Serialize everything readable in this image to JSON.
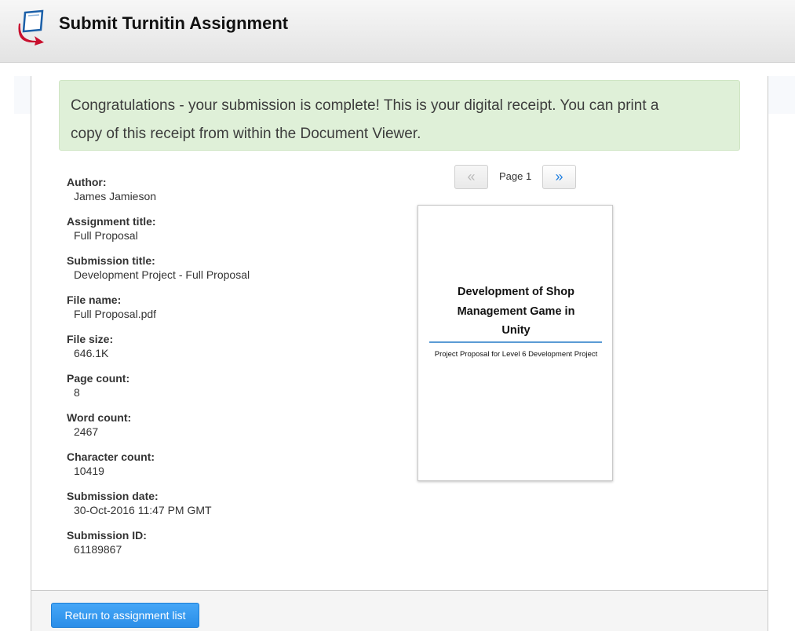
{
  "header": {
    "title": "Submit Turnitin Assignment",
    "logo_icon": "turnitin-logo-icon"
  },
  "alert": {
    "line1": "Congratulations - your submission is complete! This is your digital receipt. You can print a",
    "line2": "copy of this receipt from within the Document Viewer."
  },
  "details": [
    {
      "label": "Author:",
      "value": "James Jamieson"
    },
    {
      "label": "Assignment title:",
      "value": "Full Proposal"
    },
    {
      "label": "Submission title:",
      "value": "Development Project - Full Proposal"
    },
    {
      "label": "File name:",
      "value": "Full Proposal.pdf"
    },
    {
      "label": "File size:",
      "value": "646.1K"
    },
    {
      "label": "Page count:",
      "value": "8"
    },
    {
      "label": "Word count:",
      "value": "2467"
    },
    {
      "label": "Character count:",
      "value": "10419"
    },
    {
      "label": "Submission date:",
      "value": "30-Oct-2016 11:47 PM GMT"
    },
    {
      "label": "Submission ID:",
      "value": "61189867"
    }
  ],
  "pager": {
    "prev_label": "«",
    "page_label": "Page 1",
    "next_label": "»"
  },
  "preview": {
    "title_line1": "Development of Shop",
    "title_line2": "Management Game in",
    "title_line3": "Unity",
    "subtitle": "Project Proposal for Level 6 Development Project"
  },
  "footer": {
    "return_label": "Return to assignment list"
  },
  "colors": {
    "success_bg": "#dff0d8",
    "primary_button": "#2a8ee8",
    "rule_blue": "#5b9bd5"
  }
}
